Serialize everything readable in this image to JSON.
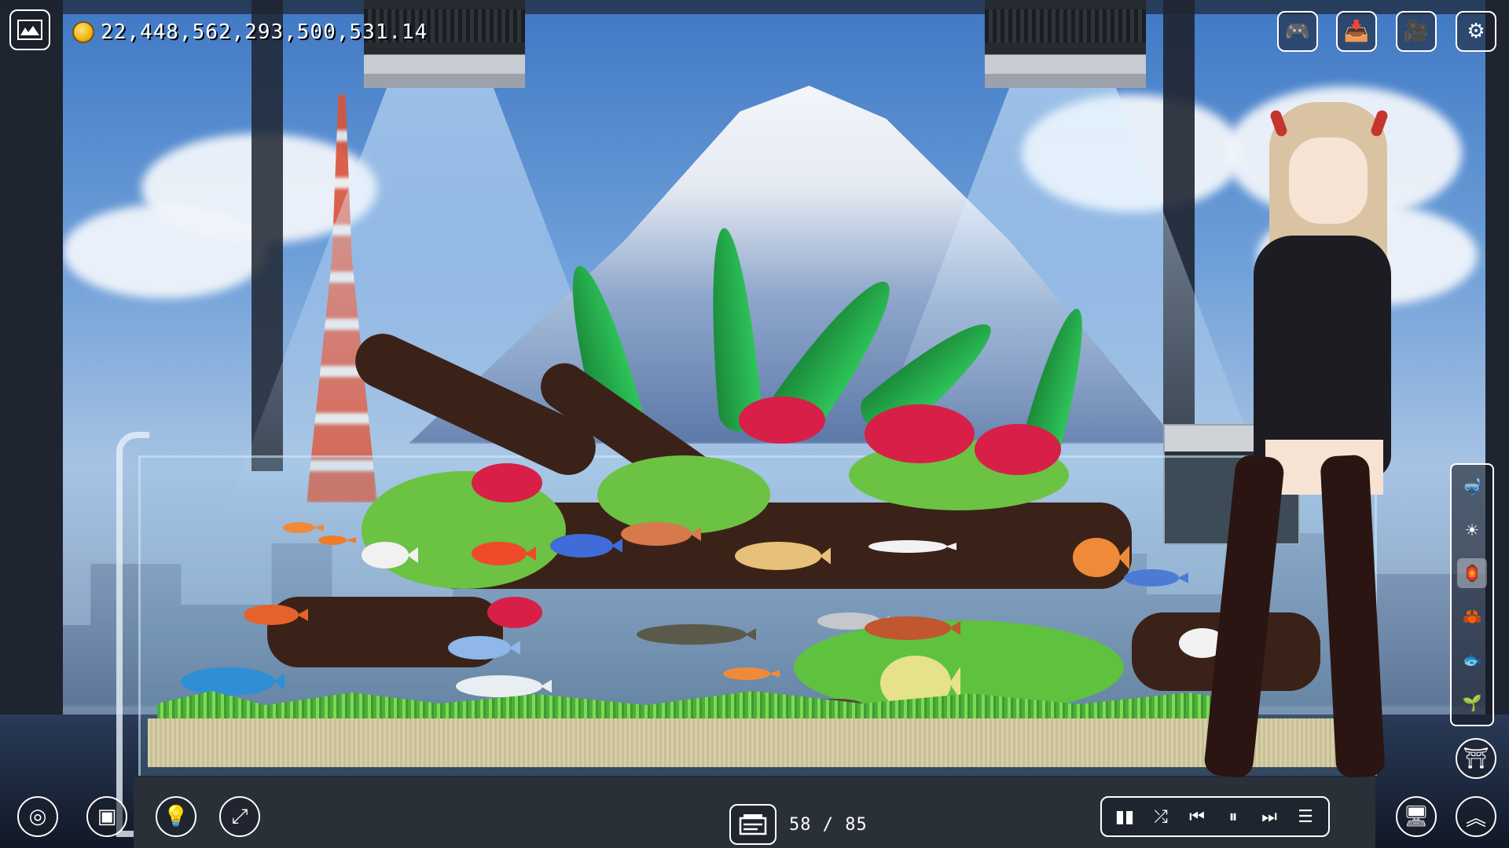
{
  "app": {
    "name": "aquarium idle game"
  },
  "top_bar": {
    "logo_icon": "aquarium-icon",
    "currency_value": "22,448,562,293,500,531.14",
    "currency_icon": "coin-icon",
    "right_buttons": [
      {
        "name": "gamepad-button",
        "icon": "gamepad-icon",
        "glyph": "🎮"
      },
      {
        "name": "inbox-button",
        "icon": "inbox-download-icon",
        "glyph": "📥"
      },
      {
        "name": "camera-button",
        "icon": "camera-icon",
        "glyph": "🎥"
      },
      {
        "name": "settings-button",
        "icon": "gear-icon",
        "glyph": "⚙"
      }
    ]
  },
  "bottom_left_buttons": [
    {
      "name": "shutter-button",
      "icon": "aperture-icon",
      "glyph": "◎"
    },
    {
      "name": "gallery-button",
      "icon": "image-edit-icon",
      "glyph": "▣"
    },
    {
      "name": "light-button",
      "icon": "light-bulb-icon",
      "glyph": "💡"
    },
    {
      "name": "fullscreen-button",
      "icon": "expand-icon",
      "glyph": "⤢"
    }
  ],
  "fish_counter": {
    "icon": "tank-list-icon",
    "value": "58 / 85"
  },
  "music_controls": [
    {
      "name": "equalizer-button",
      "icon": "equalizer-icon",
      "glyph": "▮▮"
    },
    {
      "name": "shuffle-button",
      "icon": "shuffle-icon",
      "glyph": "⤮"
    },
    {
      "name": "previous-button",
      "icon": "skip-back-icon",
      "glyph": "⏮"
    },
    {
      "name": "pause-button",
      "icon": "pause-icon",
      "glyph": "⏸"
    },
    {
      "name": "next-button",
      "icon": "skip-forward-icon",
      "glyph": "⏭"
    },
    {
      "name": "playlist-button",
      "icon": "playlist-icon",
      "glyph": "☰"
    }
  ],
  "side_panel": [
    {
      "name": "side-fish-store",
      "icon": "diver-icon",
      "glyph": "🤿",
      "active": false
    },
    {
      "name": "side-sun",
      "icon": "sun-icon",
      "glyph": "☀",
      "active": false
    },
    {
      "name": "side-decor",
      "icon": "decor-icon",
      "glyph": "🏮",
      "active": true
    },
    {
      "name": "side-creature",
      "icon": "creature-icon",
      "glyph": "🦀",
      "active": false
    },
    {
      "name": "side-fish",
      "icon": "fish-icon",
      "glyph": "🐟",
      "active": false
    },
    {
      "name": "side-plants",
      "icon": "plant-icon",
      "glyph": "🌱",
      "active": false
    }
  ],
  "bottom_right_buttons": [
    {
      "name": "upgrade-button",
      "icon": "temple-icon",
      "glyph": "⛩"
    },
    {
      "name": "display-button",
      "icon": "monitor-icon",
      "glyph": "🖥"
    },
    {
      "name": "expand-up-button",
      "icon": "double-chevron-up-icon",
      "glyph": "︽"
    }
  ],
  "colors": {
    "accent": "#ffffff",
    "coin": "#f0b613",
    "panel": "#2a3038"
  }
}
